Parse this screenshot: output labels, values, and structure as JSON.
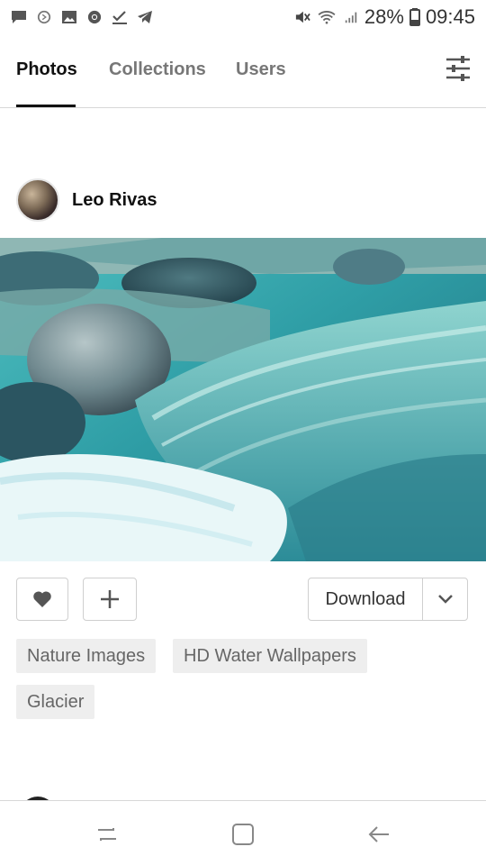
{
  "status_bar": {
    "battery": "28%",
    "time": "09:45"
  },
  "tabs": [
    {
      "label": "Photos",
      "active": true
    },
    {
      "label": "Collections",
      "active": false
    },
    {
      "label": "Users",
      "active": false
    }
  ],
  "post": {
    "author": "Leo Rivas",
    "download_label": "Download",
    "tags": [
      "Nature Images",
      "HD Water Wallpapers",
      "Glacier"
    ]
  },
  "colors": {
    "accent": "#111111",
    "tag_bg": "#eeeeee",
    "border": "#cfcfcf"
  },
  "icons": {
    "filter": "sliders-icon",
    "like": "heart-icon",
    "add": "plus-icon",
    "more": "chevron-down-icon",
    "nav": [
      "recents-icon",
      "home-icon",
      "back-icon"
    ]
  }
}
